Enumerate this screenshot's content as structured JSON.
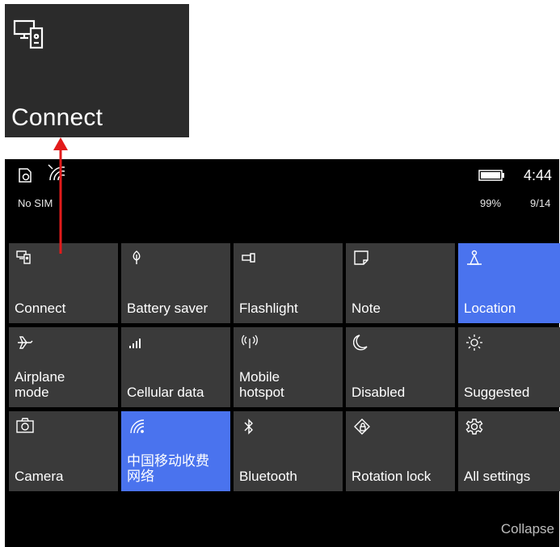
{
  "zoom_tile": {
    "label": "Connect",
    "icon": "connect-icon"
  },
  "status_bar": {
    "sim_status": "No SIM",
    "battery_percent": "99%",
    "time": "4:44",
    "date": "9/14",
    "icons": [
      "battery-saver-status-icon",
      "wifi-off-icon",
      "battery-icon"
    ]
  },
  "quick_actions": [
    {
      "label": "Connect",
      "icon": "connect-icon",
      "active": false
    },
    {
      "label": "Battery saver",
      "icon": "battery-saver-icon",
      "active": false
    },
    {
      "label": "Flashlight",
      "icon": "flashlight-icon",
      "active": false
    },
    {
      "label": "Note",
      "icon": "note-icon",
      "active": false
    },
    {
      "label": "Location",
      "icon": "location-icon",
      "active": true
    },
    {
      "label": "Airplane\nmode",
      "icon": "airplane-icon",
      "active": false
    },
    {
      "label": "Cellular data",
      "icon": "cellular-data-icon",
      "active": false
    },
    {
      "label": "Mobile\nhotspot",
      "icon": "hotspot-icon",
      "active": false
    },
    {
      "label": "Disabled",
      "icon": "moon-icon",
      "active": false
    },
    {
      "label": "Suggested",
      "icon": "brightness-icon",
      "active": false
    },
    {
      "label": "Camera",
      "icon": "camera-icon",
      "active": false
    },
    {
      "label": "中国移动收费\n网络",
      "icon": "wifi-icon",
      "active": true
    },
    {
      "label": "Bluetooth",
      "icon": "bluetooth-icon",
      "active": false
    },
    {
      "label": "Rotation lock",
      "icon": "rotation-lock-icon",
      "active": false
    },
    {
      "label": "All settings",
      "icon": "settings-gear-icon",
      "active": false
    }
  ],
  "collapse_label": "Collapse",
  "colors": {
    "accent": "#4a73ee",
    "tile": "#3a3a3a",
    "arrow": "#e21b1b"
  }
}
